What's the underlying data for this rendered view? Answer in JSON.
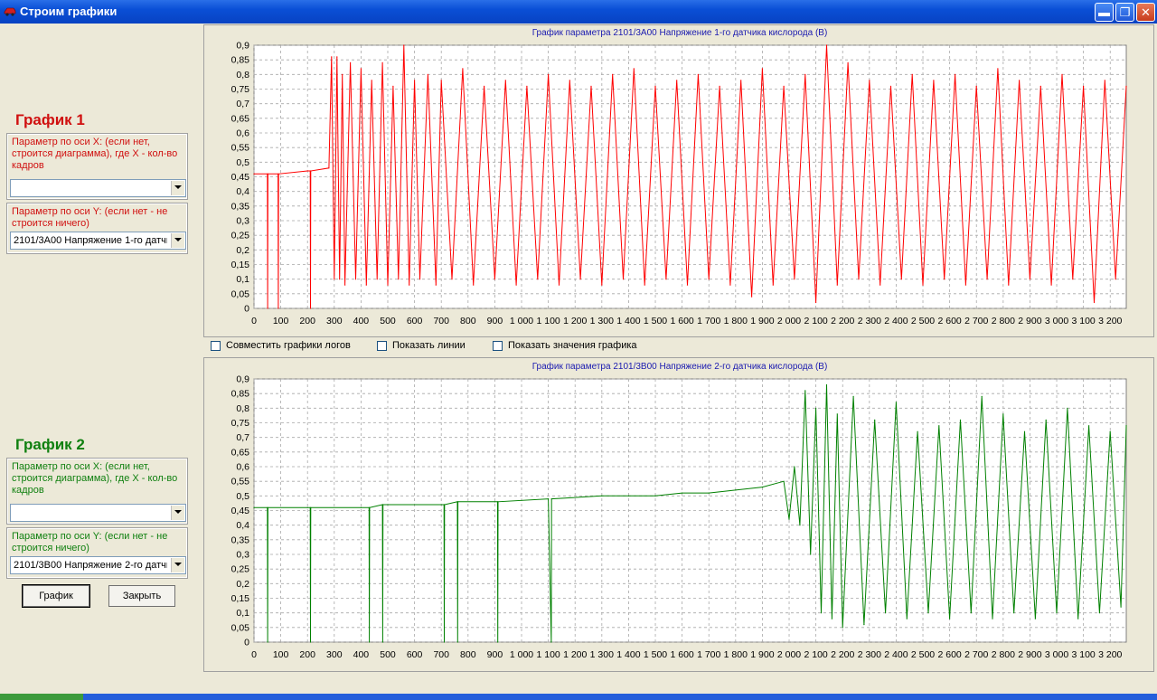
{
  "window": {
    "title": "Строим графики"
  },
  "left_panel": {
    "graph1": {
      "heading": "График 1",
      "x_param_label": "Параметр по оси X: (если нет, строится диаграмма), где X - кол-во кадров",
      "x_param_value": "",
      "y_param_label": "Параметр по оси Y: (если нет - не строится ничего)",
      "y_param_value": "2101/3A00 Напряжение 1-го датчи"
    },
    "graph2": {
      "heading": "График 2",
      "x_param_label": "Параметр по оси X: (если нет, строится диаграмма), где X - кол-во кадров",
      "x_param_value": "",
      "y_param_label": "Параметр по оси Y: (если нет - не строится ничего)",
      "y_param_value": "2101/3B00 Напряжение 2-го датчи"
    },
    "buttons": {
      "graph": "График",
      "close": "Закрыть"
    }
  },
  "options": {
    "combine_logs": "Совместить графики логов",
    "show_lines": "Показать линии",
    "show_values": "Показать значения графика"
  },
  "colors": {
    "chart1_series": "#ff0000",
    "chart2_series": "#008000",
    "chart_title": "#1a1ab0",
    "grid": "#a8a8a8"
  },
  "chart_data": [
    {
      "type": "line",
      "title": "График параметра 2101/3A00 Напряжение 1-го датчика кислорода (В)",
      "xlabel": "",
      "ylabel": "",
      "xlim": [
        0,
        3260
      ],
      "ylim": [
        0,
        0.9
      ],
      "grid": true,
      "legend": "none",
      "x_ticks": [
        "0",
        "100",
        "200",
        "300",
        "400",
        "500",
        "600",
        "700",
        "800",
        "900",
        "1 000",
        "1 100",
        "1 200",
        "1 300",
        "1 400",
        "1 500",
        "1 600",
        "1 700",
        "1 800",
        "1 900",
        "2 000",
        "2 100",
        "2 200",
        "2 300",
        "2 400",
        "2 500",
        "2 600",
        "2 700",
        "2 800",
        "2 900",
        "3 000",
        "3 100",
        "3 200"
      ],
      "y_ticks": [
        "0",
        "0,05",
        "0,1",
        "0,15",
        "0,2",
        "0,25",
        "0,3",
        "0,35",
        "0,4",
        "0,45",
        "0,5",
        "0,55",
        "0,6",
        "0,65",
        "0,7",
        "0,75",
        "0,8",
        "0,85",
        "0,9"
      ],
      "series": [
        {
          "color": "#ff0000",
          "points": [
            [
              0,
              0.46
            ],
            [
              50,
              0.46
            ],
            [
              51,
              0.0
            ],
            [
              52,
              0.46
            ],
            [
              90,
              0.46
            ],
            [
              91,
              0.0
            ],
            [
              92,
              0.46
            ],
            [
              200,
              0.47
            ],
            [
              210,
              0.47
            ],
            [
              211,
              0.0
            ],
            [
              212,
              0.47
            ],
            [
              280,
              0.48
            ],
            [
              290,
              0.86
            ],
            [
              300,
              0.1
            ],
            [
              310,
              0.86
            ],
            [
              320,
              0.1
            ],
            [
              330,
              0.8
            ],
            [
              340,
              0.08
            ],
            [
              360,
              0.84
            ],
            [
              380,
              0.1
            ],
            [
              400,
              0.82
            ],
            [
              420,
              0.08
            ],
            [
              440,
              0.78
            ],
            [
              460,
              0.1
            ],
            [
              480,
              0.84
            ],
            [
              500,
              0.08
            ],
            [
              520,
              0.76
            ],
            [
              540,
              0.1
            ],
            [
              560,
              0.9
            ],
            [
              580,
              0.08
            ],
            [
              600,
              0.78
            ],
            [
              620,
              0.1
            ],
            [
              650,
              0.8
            ],
            [
              680,
              0.08
            ],
            [
              700,
              0.78
            ],
            [
              740,
              0.1
            ],
            [
              780,
              0.82
            ],
            [
              820,
              0.08
            ],
            [
              860,
              0.76
            ],
            [
              900,
              0.1
            ],
            [
              940,
              0.78
            ],
            [
              980,
              0.08
            ],
            [
              1020,
              0.76
            ],
            [
              1060,
              0.1
            ],
            [
              1100,
              0.8
            ],
            [
              1140,
              0.08
            ],
            [
              1180,
              0.78
            ],
            [
              1220,
              0.1
            ],
            [
              1260,
              0.76
            ],
            [
              1300,
              0.08
            ],
            [
              1340,
              0.8
            ],
            [
              1380,
              0.1
            ],
            [
              1420,
              0.82
            ],
            [
              1460,
              0.08
            ],
            [
              1500,
              0.76
            ],
            [
              1540,
              0.1
            ],
            [
              1580,
              0.78
            ],
            [
              1620,
              0.08
            ],
            [
              1660,
              0.8
            ],
            [
              1700,
              0.1
            ],
            [
              1740,
              0.76
            ],
            [
              1780,
              0.08
            ],
            [
              1820,
              0.78
            ],
            [
              1860,
              0.04
            ],
            [
              1900,
              0.82
            ],
            [
              1940,
              0.08
            ],
            [
              1980,
              0.76
            ],
            [
              2020,
              0.1
            ],
            [
              2060,
              0.8
            ],
            [
              2100,
              0.02
            ],
            [
              2140,
              0.9
            ],
            [
              2180,
              0.08
            ],
            [
              2220,
              0.84
            ],
            [
              2260,
              0.1
            ],
            [
              2300,
              0.78
            ],
            [
              2340,
              0.08
            ],
            [
              2380,
              0.76
            ],
            [
              2420,
              0.1
            ],
            [
              2460,
              0.8
            ],
            [
              2500,
              0.08
            ],
            [
              2540,
              0.78
            ],
            [
              2580,
              0.1
            ],
            [
              2620,
              0.8
            ],
            [
              2660,
              0.08
            ],
            [
              2700,
              0.76
            ],
            [
              2740,
              0.1
            ],
            [
              2780,
              0.82
            ],
            [
              2820,
              0.08
            ],
            [
              2860,
              0.78
            ],
            [
              2900,
              0.1
            ],
            [
              2940,
              0.76
            ],
            [
              2980,
              0.08
            ],
            [
              3020,
              0.8
            ],
            [
              3060,
              0.1
            ],
            [
              3100,
              0.76
            ],
            [
              3140,
              0.02
            ],
            [
              3180,
              0.78
            ],
            [
              3220,
              0.1
            ],
            [
              3260,
              0.76
            ]
          ]
        }
      ]
    },
    {
      "type": "line",
      "title": "График параметра 2101/3B00 Напряжение 2-го датчика кислорода (В)",
      "xlabel": "",
      "ylabel": "",
      "xlim": [
        0,
        3260
      ],
      "ylim": [
        0,
        0.9
      ],
      "grid": true,
      "legend": "none",
      "x_ticks": [
        "0",
        "100",
        "200",
        "300",
        "400",
        "500",
        "600",
        "700",
        "800",
        "900",
        "1 000",
        "1 100",
        "1 200",
        "1 300",
        "1 400",
        "1 500",
        "1 600",
        "1 700",
        "1 800",
        "1 900",
        "2 000",
        "2 100",
        "2 200",
        "2 300",
        "2 400",
        "2 500",
        "2 600",
        "2 700",
        "2 800",
        "2 900",
        "3 000",
        "3 100",
        "3 200"
      ],
      "y_ticks": [
        "0",
        "0,05",
        "0,1",
        "0,15",
        "0,2",
        "0,25",
        "0,3",
        "0,35",
        "0,4",
        "0,45",
        "0,5",
        "0,55",
        "0,6",
        "0,65",
        "0,7",
        "0,75",
        "0,8",
        "0,85",
        "0,9"
      ],
      "series": [
        {
          "color": "#008000",
          "points": [
            [
              0,
              0.46
            ],
            [
              50,
              0.46
            ],
            [
              51,
              0.0
            ],
            [
              52,
              0.46
            ],
            [
              200,
              0.46
            ],
            [
              210,
              0.46
            ],
            [
              211,
              0.0
            ],
            [
              212,
              0.46
            ],
            [
              400,
              0.46
            ],
            [
              430,
              0.46
            ],
            [
              431,
              0.0
            ],
            [
              432,
              0.46
            ],
            [
              480,
              0.47
            ],
            [
              481,
              0.0
            ],
            [
              482,
              0.47
            ],
            [
              700,
              0.47
            ],
            [
              710,
              0.47
            ],
            [
              711,
              0.0
            ],
            [
              712,
              0.47
            ],
            [
              760,
              0.48
            ],
            [
              761,
              0.0
            ],
            [
              762,
              0.48
            ],
            [
              900,
              0.48
            ],
            [
              910,
              0.48
            ],
            [
              911,
              0.0
            ],
            [
              912,
              0.48
            ],
            [
              1100,
              0.49
            ],
            [
              1111,
              0.0
            ],
            [
              1112,
              0.49
            ],
            [
              1300,
              0.5
            ],
            [
              1400,
              0.5
            ],
            [
              1500,
              0.5
            ],
            [
              1600,
              0.51
            ],
            [
              1700,
              0.51
            ],
            [
              1800,
              0.52
            ],
            [
              1900,
              0.53
            ],
            [
              1980,
              0.55
            ],
            [
              2000,
              0.42
            ],
            [
              2020,
              0.6
            ],
            [
              2040,
              0.4
            ],
            [
              2060,
              0.86
            ],
            [
              2080,
              0.3
            ],
            [
              2100,
              0.8
            ],
            [
              2120,
              0.1
            ],
            [
              2140,
              0.88
            ],
            [
              2160,
              0.08
            ],
            [
              2180,
              0.78
            ],
            [
              2200,
              0.05
            ],
            [
              2240,
              0.84
            ],
            [
              2280,
              0.06
            ],
            [
              2320,
              0.76
            ],
            [
              2360,
              0.1
            ],
            [
              2400,
              0.82
            ],
            [
              2440,
              0.08
            ],
            [
              2480,
              0.72
            ],
            [
              2520,
              0.1
            ],
            [
              2560,
              0.74
            ],
            [
              2600,
              0.08
            ],
            [
              2640,
              0.76
            ],
            [
              2680,
              0.1
            ],
            [
              2720,
              0.84
            ],
            [
              2760,
              0.08
            ],
            [
              2800,
              0.78
            ],
            [
              2840,
              0.1
            ],
            [
              2880,
              0.72
            ],
            [
              2920,
              0.08
            ],
            [
              2960,
              0.76
            ],
            [
              3000,
              0.1
            ],
            [
              3040,
              0.8
            ],
            [
              3080,
              0.08
            ],
            [
              3120,
              0.74
            ],
            [
              3160,
              0.1
            ],
            [
              3200,
              0.72
            ],
            [
              3240,
              0.12
            ],
            [
              3260,
              0.74
            ]
          ]
        }
      ]
    }
  ]
}
